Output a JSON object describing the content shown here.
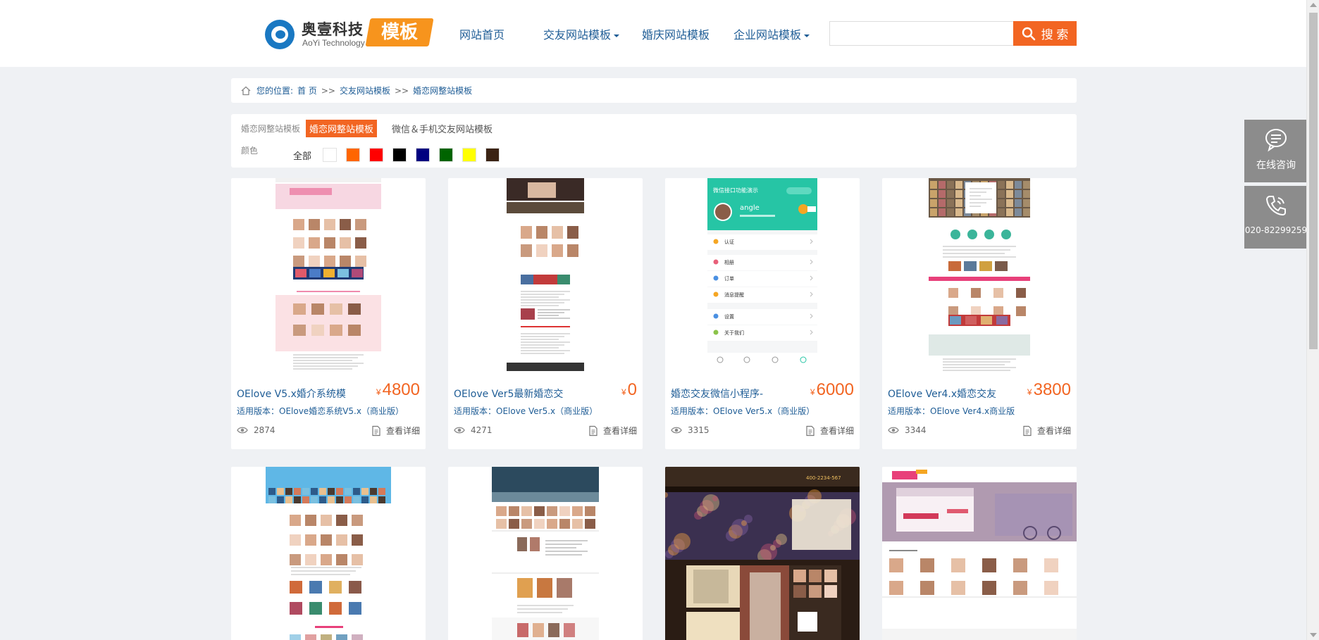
{
  "logo": {
    "cn": "奥壹科技",
    "en": "AoYi Technology",
    "badge": "模板"
  },
  "nav": {
    "items": [
      {
        "label": "网站首页",
        "dropdown": false
      },
      {
        "label": "交友网站模板",
        "dropdown": true
      },
      {
        "label": "婚庆网站模板",
        "dropdown": false
      },
      {
        "label": "企业网站模板",
        "dropdown": true
      }
    ]
  },
  "search": {
    "placeholder": "",
    "value": "",
    "button": "搜 索"
  },
  "breadcrumb": {
    "prefix": "您的位置:",
    "home": "首 页",
    "sep": ">>",
    "level1": "交友网站模板",
    "level2": "婚恋网整站模板"
  },
  "filter": {
    "category_label": "婚恋网整站模板",
    "tags": [
      "婚恋网整站模板",
      "微信＆手机交友网站模板"
    ],
    "color_label": "颜色",
    "color_all": "全部",
    "colors": [
      "#ffffff",
      "#ff6600",
      "#ff0000",
      "#000000",
      "#000080",
      "#006400",
      "#ffff00",
      "#3b2314"
    ]
  },
  "products": [
    {
      "title": "OElove V5.x婚介系统模",
      "price": "4800",
      "version": "适用版本：OElove婚恋系统V5.x（商业版）",
      "views": "2874",
      "detail": "查看详细",
      "thumb": "t1"
    },
    {
      "title": "OElove Ver5最新婚恋交",
      "price": "0",
      "version": "适用版本：OElove Ver5.x（商业版）",
      "views": "4271",
      "detail": "查看详细",
      "thumb": "t2"
    },
    {
      "title": "婚恋交友微信小程序-",
      "price": "6000",
      "version": "适用版本：OElove Ver5.x（商业版）",
      "views": "3315",
      "detail": "查看详细",
      "thumb": "t3"
    },
    {
      "title": "OElove Ver4.x婚恋交友",
      "price": "3800",
      "version": "适用版本：OElove Ver4.x商业版",
      "views": "3344",
      "detail": "查看详细",
      "thumb": "t4"
    },
    {
      "title": "",
      "price": "",
      "version": "",
      "views": "",
      "detail": "",
      "thumb": "t5"
    },
    {
      "title": "",
      "price": "",
      "version": "",
      "views": "",
      "detail": "",
      "thumb": "t6"
    },
    {
      "title": "",
      "price": "",
      "version": "",
      "views": "",
      "detail": "",
      "thumb": "t7"
    },
    {
      "title": "",
      "price": "",
      "version": "",
      "views": "",
      "detail": "",
      "thumb": "t8"
    }
  ],
  "currency": "¥",
  "phone_thumb": {
    "header": "微信接口功能演示",
    "name": "angle",
    "menu": [
      "认证",
      "相册",
      "订单",
      "消息提醒",
      "设置",
      "关于我们"
    ]
  },
  "side": {
    "consult": "在线咨询",
    "phone": "020-82299259"
  }
}
